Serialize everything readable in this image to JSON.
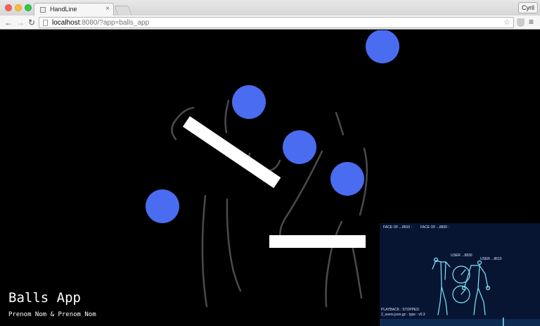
{
  "browser": {
    "tab_title": "HandLine",
    "tab_close": "×",
    "profile_name": "Cyril",
    "url_host": "localhost",
    "url_rest": ":8080/?app=balls_app",
    "nav_back": "←",
    "nav_forward": "→",
    "nav_reload": "↻",
    "star": "☆",
    "menu": "≡"
  },
  "app": {
    "title": "Balls App",
    "subtitle": "Prenom Nom & Prenom Nom",
    "ball_color": "#4a6cf0",
    "bar_color": "#ffffff",
    "figure_stroke": "#4a4a4a"
  },
  "overlay": {
    "face_label_1": "FACE OF ...8610 :",
    "face_label_2": "FACE OF ...8830 :",
    "user_label_1": "USER ...8830",
    "user_label_2": "USER ...8610",
    "playback_label": "PLAYBACK :  STOPPED",
    "file_label": "2_users.json.gz - type : v0.3",
    "background_color": "#071532",
    "skeleton_color": "#7fe6ff"
  },
  "icons": {
    "favicon": "page-icon",
    "back": "arrow-left-icon",
    "forward": "arrow-right-icon",
    "reload": "reload-icon",
    "bookmark": "star-icon",
    "extension": "shield-icon",
    "menu": "hamburger-icon"
  }
}
